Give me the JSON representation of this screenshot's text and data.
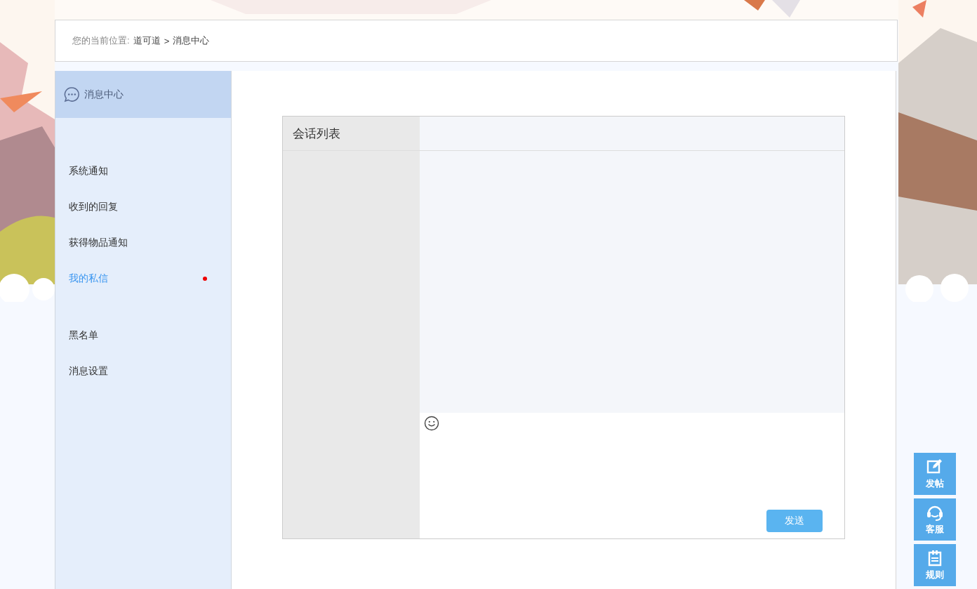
{
  "breadcrumb": {
    "label": "您的当前位置:",
    "separator": ">",
    "items": [
      "道可道",
      "消息中心"
    ]
  },
  "sidebar": {
    "title": "消息中心",
    "groups": [
      [
        {
          "label": "系统通知",
          "selected": false,
          "unread": false
        },
        {
          "label": "收到的回复",
          "selected": false,
          "unread": false
        },
        {
          "label": "获得物品通知",
          "selected": false,
          "unread": false
        },
        {
          "label": "我的私信",
          "selected": true,
          "unread": true
        }
      ],
      [
        {
          "label": "黑名单",
          "selected": false,
          "unread": false
        },
        {
          "label": "消息设置",
          "selected": false,
          "unread": false
        }
      ]
    ]
  },
  "chat": {
    "list_title": "会话列表",
    "send_button": "发送"
  },
  "float_tools": [
    {
      "kind": "edit",
      "label": "发帖"
    },
    {
      "kind": "support",
      "label": "客服"
    },
    {
      "kind": "rules",
      "label": "规则"
    }
  ]
}
